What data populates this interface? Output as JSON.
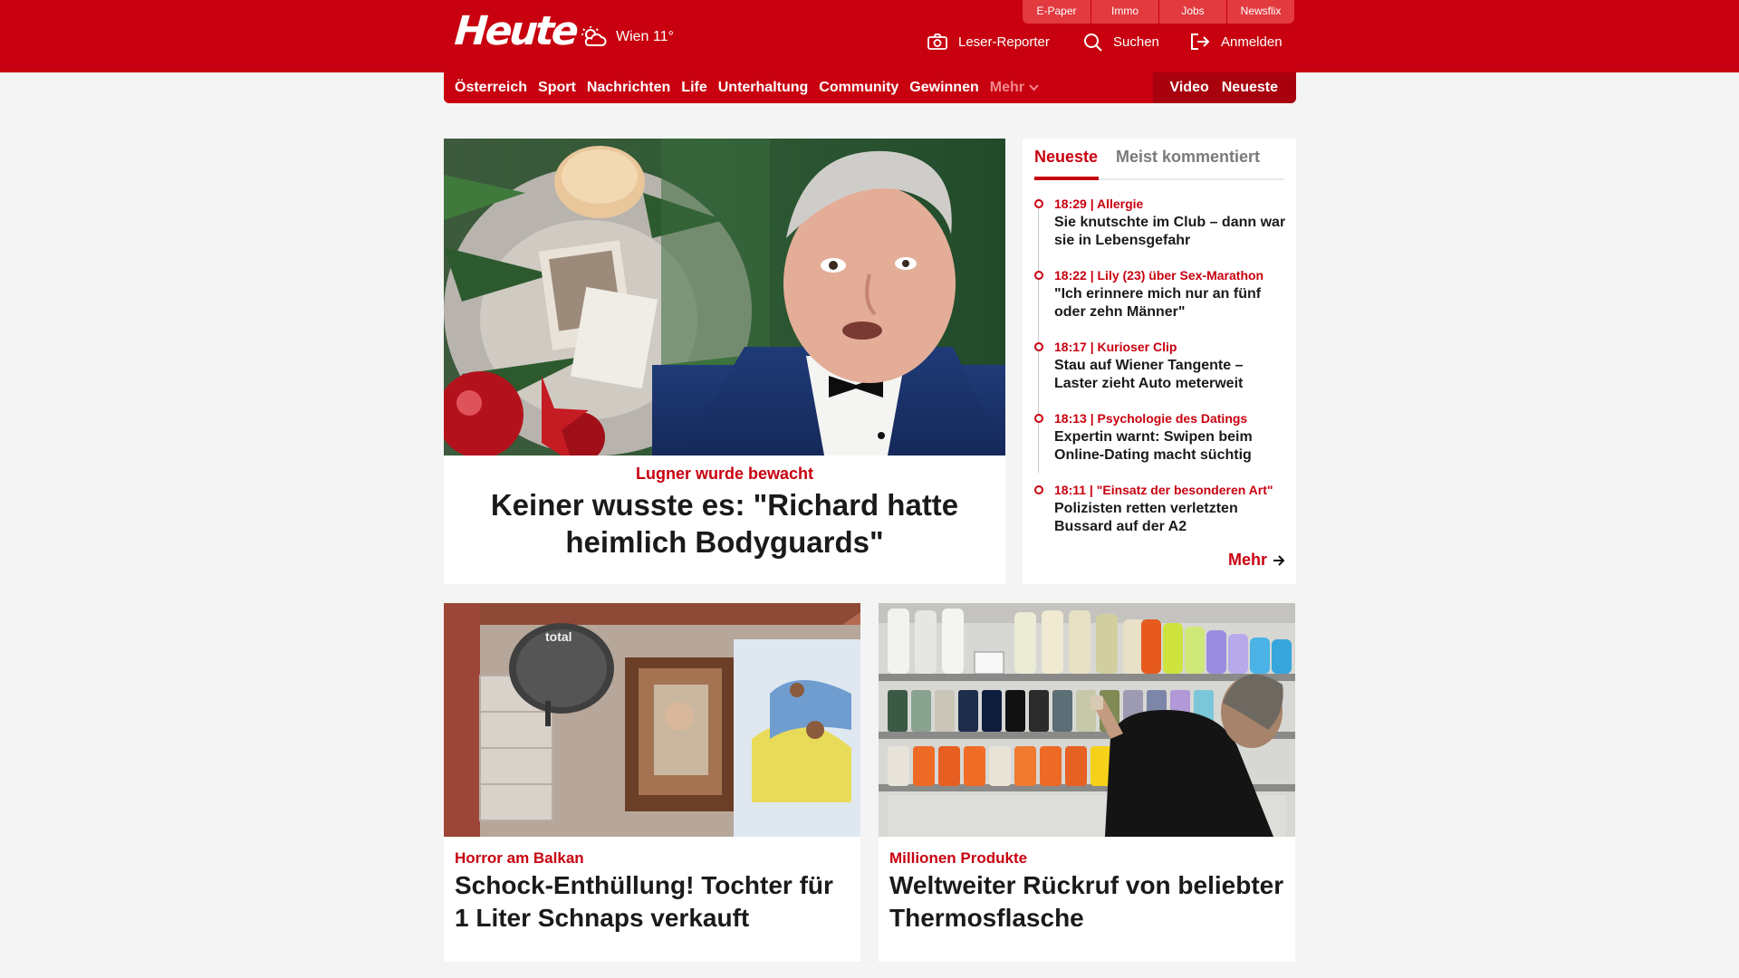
{
  "header": {
    "logo": "Heute",
    "weather": "Wien 11°",
    "top_links": [
      "E-Paper",
      "Immo",
      "Jobs",
      "Newsflix"
    ],
    "actions": {
      "reporter": "Leser-Reporter",
      "search": "Suchen",
      "login": "Anmelden"
    }
  },
  "nav": {
    "items": [
      "Österreich",
      "Sport",
      "Nachrichten",
      "Life",
      "Unterhaltung",
      "Community",
      "Gewinnen"
    ],
    "more": "Mehr",
    "right": [
      "Video",
      "Neueste"
    ]
  },
  "hero": {
    "kicker": "Lugner wurde bewacht",
    "title": "Keiner wusste es: \"Richard hatte heimlich Bodyguards\""
  },
  "sidebar": {
    "tabs": [
      "Neueste",
      "Meist kommentiert"
    ],
    "items": [
      {
        "meta": "18:29 | Allergie",
        "title": "Sie knutschte im Club – dann war sie in Lebensgefahr"
      },
      {
        "meta": "18:22 | Lily (23) über Sex-Marathon",
        "title": "\"Ich erinnere mich nur an fünf oder zehn Männer\""
      },
      {
        "meta": "18:17 | Kurioser Clip",
        "title": "Stau auf Wiener Tangente – Laster zieht Auto meterweit"
      },
      {
        "meta": "18:13 | Psychologie des Datings",
        "title": "Expertin warnt: Swipen beim Online-Dating macht süchtig"
      },
      {
        "meta": "18:11 | \"Einsatz der besonderen Art\"",
        "title": "Polizisten retten verletzten Bussard auf der A2"
      }
    ],
    "more": "Mehr"
  },
  "cards": [
    {
      "kicker": "Horror am Balkan",
      "title": "Schock-Enthüllung! Tochter für 1 Liter Schnaps verkauft"
    },
    {
      "kicker": "Millionen Produkte",
      "title": "Weltweiter Rückruf von beliebter Thermosflasche"
    }
  ],
  "colors": {
    "brand": "#c8000f",
    "brand_dark": "#a8000c",
    "page_bg": "#f4f4f4"
  },
  "icons": [
    "cloud-sun-icon",
    "camera-icon",
    "search-icon",
    "login-icon",
    "chevron-down-icon",
    "arrow-right-icon"
  ]
}
